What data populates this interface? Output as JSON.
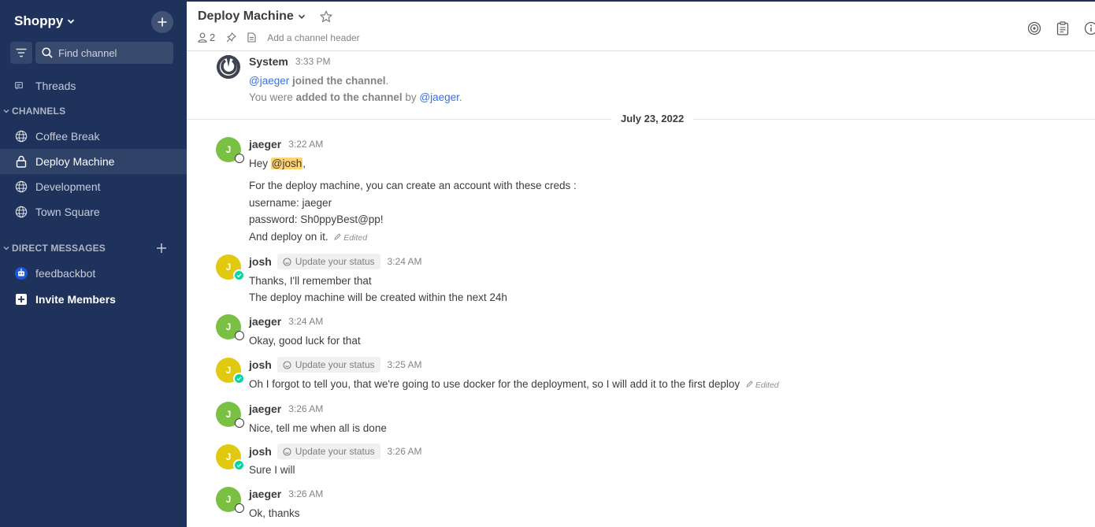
{
  "team": {
    "name": "Shoppy"
  },
  "search": {
    "placeholder": "Find channel"
  },
  "sidebar": {
    "threads_label": "Threads",
    "channels_heading": "CHANNELS",
    "channels": [
      {
        "label": "Coffee Break",
        "icon": "globe-icon"
      },
      {
        "label": "Deploy Machine",
        "icon": "lock-icon",
        "active": true
      },
      {
        "label": "Development",
        "icon": "globe-icon"
      },
      {
        "label": "Town Square",
        "icon": "globe-icon"
      }
    ],
    "dm_heading": "DIRECT MESSAGES",
    "dms": [
      {
        "label": "feedbackbot",
        "icon": "bot-icon"
      }
    ],
    "invite_label": "Invite Members"
  },
  "header": {
    "title": "Deploy Machine",
    "member_count": "2",
    "placeholder": "Add a channel header"
  },
  "system_post": {
    "author": "System",
    "time": "3:33 PM",
    "line1_mention": "@jaeger",
    "line1_text": "joined the channel",
    "line1_end": ".",
    "line2_pre": "You were",
    "line2_bold": "added to the channel",
    "line2_mid": "by",
    "line2_mention": "@jaeger",
    "line2_end": "."
  },
  "date_separator": "July 23, 2022",
  "status_pill_label": "Update your status",
  "edited_label": "Edited",
  "posts": [
    {
      "author": "jaeger",
      "initial": "J",
      "time": "3:22 AM",
      "greeting": "Hey",
      "mention": "@josh",
      "greeting_end": ",",
      "lines": [
        "For the deploy machine, you can create an account with these creds :",
        "username: jaeger",
        "password: Sh0ppyBest@pp!",
        "And deploy on it."
      ]
    },
    {
      "author": "josh",
      "initial": "J",
      "time": "3:24 AM",
      "lines": [
        "Thanks, I'll remember that",
        "The deploy machine will be created within the next 24h"
      ]
    },
    {
      "author": "jaeger",
      "initial": "J",
      "time": "3:24 AM",
      "lines": [
        "Okay, good luck for that"
      ]
    },
    {
      "author": "josh",
      "initial": "J",
      "time": "3:25 AM",
      "lines": [
        "Oh I forgot to tell you, that we're going to use docker for the deployment, so I will add it to the first deploy"
      ]
    },
    {
      "author": "jaeger",
      "initial": "J",
      "time": "3:26 AM",
      "lines": [
        "Nice, tell me when all is done"
      ]
    },
    {
      "author": "josh",
      "initial": "J",
      "time": "3:26 AM",
      "lines": [
        "Sure I will"
      ]
    },
    {
      "author": "jaeger",
      "initial": "J",
      "time": "3:26 AM",
      "lines": [
        "Ok, thanks"
      ]
    }
  ],
  "colors": {
    "sidebar_bg": "#1e325c",
    "mention": "#386fe5",
    "mention_highlight": "#ffd470",
    "online": "#06d6a0"
  }
}
